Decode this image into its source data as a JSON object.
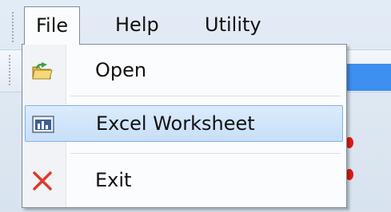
{
  "menubar": {
    "items": [
      {
        "label": "File"
      },
      {
        "label": "Help"
      },
      {
        "label": "Utility"
      }
    ]
  },
  "file_menu": {
    "items": [
      {
        "label": "Open",
        "icon": "open-folder-icon"
      },
      {
        "label": "Excel Worksheet",
        "icon": "excel-worksheet-icon",
        "highlighted": true
      },
      {
        "label": "Exit",
        "icon": "exit-x-icon"
      }
    ]
  },
  "colors": {
    "highlight": "#c7dff8",
    "highlight_border": "#7eb4ea",
    "exit_icon": "#e03a2c",
    "toolbar_blue": "#3d8ff0"
  }
}
